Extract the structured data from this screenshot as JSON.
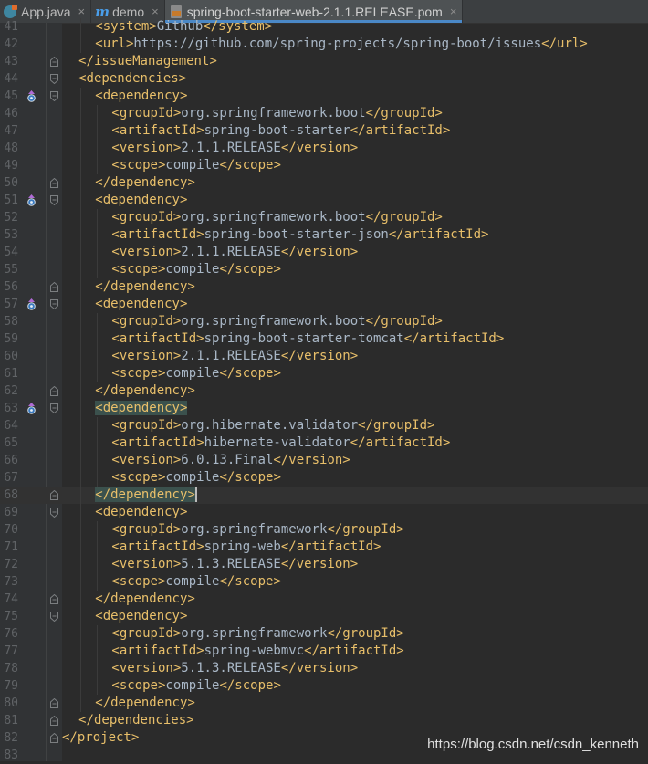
{
  "tabs": [
    {
      "label": "App.java",
      "icon": "java-class-icon",
      "active": false,
      "close": "×"
    },
    {
      "label": "demo",
      "icon": "maven-m-icon",
      "active": false,
      "close": "×"
    },
    {
      "label": "spring-boot-starter-web-2.1.1.RELEASE.pom",
      "icon": "pom-file-icon",
      "active": true,
      "close": "×"
    }
  ],
  "colors": {
    "background": "#2b2b2b",
    "tag": "#e8bf6a",
    "text": "#a9b7c6",
    "line_number": "#606366",
    "matched_tag_bg": "#3b514d"
  },
  "lines": [
    {
      "n": "41",
      "indent": 4,
      "parts": [
        [
          "t",
          "<system>"
        ],
        [
          "x",
          "Github"
        ],
        [
          "t",
          "</system>"
        ]
      ]
    },
    {
      "n": "42",
      "indent": 4,
      "parts": [
        [
          "t",
          "<url>"
        ],
        [
          "x",
          "https://github.com/spring-projects/spring-boot/issues"
        ],
        [
          "t",
          "</url>"
        ]
      ]
    },
    {
      "n": "43",
      "indent": 2,
      "fold": "end",
      "parts": [
        [
          "t",
          "</issueManagement>"
        ]
      ]
    },
    {
      "n": "44",
      "indent": 2,
      "fold": "start",
      "parts": [
        [
          "t",
          "<dependencies>"
        ]
      ]
    },
    {
      "n": "45",
      "indent": 4,
      "fold": "start",
      "impl": true,
      "parts": [
        [
          "t",
          "<dependency>"
        ]
      ]
    },
    {
      "n": "46",
      "indent": 6,
      "parts": [
        [
          "t",
          "<groupId>"
        ],
        [
          "x",
          "org.springframework.boot"
        ],
        [
          "t",
          "</groupId>"
        ]
      ]
    },
    {
      "n": "47",
      "indent": 6,
      "parts": [
        [
          "t",
          "<artifactId>"
        ],
        [
          "x",
          "spring-boot-starter"
        ],
        [
          "t",
          "</artifactId>"
        ]
      ]
    },
    {
      "n": "48",
      "indent": 6,
      "parts": [
        [
          "t",
          "<version>"
        ],
        [
          "x",
          "2.1.1.RELEASE"
        ],
        [
          "t",
          "</version>"
        ]
      ]
    },
    {
      "n": "49",
      "indent": 6,
      "parts": [
        [
          "t",
          "<scope>"
        ],
        [
          "x",
          "compile"
        ],
        [
          "t",
          "</scope>"
        ]
      ]
    },
    {
      "n": "50",
      "indent": 4,
      "fold": "end",
      "parts": [
        [
          "t",
          "</dependency>"
        ]
      ]
    },
    {
      "n": "51",
      "indent": 4,
      "fold": "start",
      "impl": true,
      "parts": [
        [
          "t",
          "<dependency>"
        ]
      ]
    },
    {
      "n": "52",
      "indent": 6,
      "parts": [
        [
          "t",
          "<groupId>"
        ],
        [
          "x",
          "org.springframework.boot"
        ],
        [
          "t",
          "</groupId>"
        ]
      ]
    },
    {
      "n": "53",
      "indent": 6,
      "parts": [
        [
          "t",
          "<artifactId>"
        ],
        [
          "x",
          "spring-boot-starter-json"
        ],
        [
          "t",
          "</artifactId>"
        ]
      ]
    },
    {
      "n": "54",
      "indent": 6,
      "parts": [
        [
          "t",
          "<version>"
        ],
        [
          "x",
          "2.1.1.RELEASE"
        ],
        [
          "t",
          "</version>"
        ]
      ]
    },
    {
      "n": "55",
      "indent": 6,
      "parts": [
        [
          "t",
          "<scope>"
        ],
        [
          "x",
          "compile"
        ],
        [
          "t",
          "</scope>"
        ]
      ]
    },
    {
      "n": "56",
      "indent": 4,
      "fold": "end",
      "parts": [
        [
          "t",
          "</dependency>"
        ]
      ]
    },
    {
      "n": "57",
      "indent": 4,
      "fold": "start",
      "impl": true,
      "parts": [
        [
          "t",
          "<dependency>"
        ]
      ]
    },
    {
      "n": "58",
      "indent": 6,
      "parts": [
        [
          "t",
          "<groupId>"
        ],
        [
          "x",
          "org.springframework.boot"
        ],
        [
          "t",
          "</groupId>"
        ]
      ]
    },
    {
      "n": "59",
      "indent": 6,
      "parts": [
        [
          "t",
          "<artifactId>"
        ],
        [
          "x",
          "spring-boot-starter-tomcat"
        ],
        [
          "t",
          "</artifactId>"
        ]
      ]
    },
    {
      "n": "60",
      "indent": 6,
      "parts": [
        [
          "t",
          "<version>"
        ],
        [
          "x",
          "2.1.1.RELEASE"
        ],
        [
          "t",
          "</version>"
        ]
      ]
    },
    {
      "n": "61",
      "indent": 6,
      "parts": [
        [
          "t",
          "<scope>"
        ],
        [
          "x",
          "compile"
        ],
        [
          "t",
          "</scope>"
        ]
      ]
    },
    {
      "n": "62",
      "indent": 4,
      "fold": "end",
      "parts": [
        [
          "t",
          "</dependency>"
        ]
      ]
    },
    {
      "n": "63",
      "indent": 4,
      "fold": "start",
      "impl": true,
      "parts": [
        [
          "hl",
          "<dependency>"
        ]
      ]
    },
    {
      "n": "64",
      "indent": 6,
      "parts": [
        [
          "t",
          "<groupId>"
        ],
        [
          "x",
          "org.hibernate.validator"
        ],
        [
          "t",
          "</groupId>"
        ]
      ]
    },
    {
      "n": "65",
      "indent": 6,
      "parts": [
        [
          "t",
          "<artifactId>"
        ],
        [
          "x",
          "hibernate-validator"
        ],
        [
          "t",
          "</artifactId>"
        ]
      ]
    },
    {
      "n": "66",
      "indent": 6,
      "parts": [
        [
          "t",
          "<version>"
        ],
        [
          "x",
          "6.0.13.Final"
        ],
        [
          "t",
          "</version>"
        ]
      ]
    },
    {
      "n": "67",
      "indent": 6,
      "parts": [
        [
          "t",
          "<scope>"
        ],
        [
          "x",
          "compile"
        ],
        [
          "t",
          "</scope>"
        ]
      ]
    },
    {
      "n": "68",
      "indent": 4,
      "fold": "end",
      "current": true,
      "caret": true,
      "parts": [
        [
          "hl",
          "</dependency>"
        ]
      ]
    },
    {
      "n": "69",
      "indent": 4,
      "fold": "start",
      "parts": [
        [
          "t",
          "<dependency>"
        ]
      ]
    },
    {
      "n": "70",
      "indent": 6,
      "parts": [
        [
          "t",
          "<groupId>"
        ],
        [
          "x",
          "org.springframework"
        ],
        [
          "t",
          "</groupId>"
        ]
      ]
    },
    {
      "n": "71",
      "indent": 6,
      "parts": [
        [
          "t",
          "<artifactId>"
        ],
        [
          "x",
          "spring-web"
        ],
        [
          "t",
          "</artifactId>"
        ]
      ]
    },
    {
      "n": "72",
      "indent": 6,
      "parts": [
        [
          "t",
          "<version>"
        ],
        [
          "x",
          "5.1.3.RELEASE"
        ],
        [
          "t",
          "</version>"
        ]
      ]
    },
    {
      "n": "73",
      "indent": 6,
      "parts": [
        [
          "t",
          "<scope>"
        ],
        [
          "x",
          "compile"
        ],
        [
          "t",
          "</scope>"
        ]
      ]
    },
    {
      "n": "74",
      "indent": 4,
      "fold": "end",
      "parts": [
        [
          "t",
          "</dependency>"
        ]
      ]
    },
    {
      "n": "75",
      "indent": 4,
      "fold": "start",
      "parts": [
        [
          "t",
          "<dependency>"
        ]
      ]
    },
    {
      "n": "76",
      "indent": 6,
      "parts": [
        [
          "t",
          "<groupId>"
        ],
        [
          "x",
          "org.springframework"
        ],
        [
          "t",
          "</groupId>"
        ]
      ]
    },
    {
      "n": "77",
      "indent": 6,
      "parts": [
        [
          "t",
          "<artifactId>"
        ],
        [
          "x",
          "spring-webmvc"
        ],
        [
          "t",
          "</artifactId>"
        ]
      ]
    },
    {
      "n": "78",
      "indent": 6,
      "parts": [
        [
          "t",
          "<version>"
        ],
        [
          "x",
          "5.1.3.RELEASE"
        ],
        [
          "t",
          "</version>"
        ]
      ]
    },
    {
      "n": "79",
      "indent": 6,
      "parts": [
        [
          "t",
          "<scope>"
        ],
        [
          "x",
          "compile"
        ],
        [
          "t",
          "</scope>"
        ]
      ]
    },
    {
      "n": "80",
      "indent": 4,
      "fold": "end",
      "parts": [
        [
          "t",
          "</dependency>"
        ]
      ]
    },
    {
      "n": "81",
      "indent": 2,
      "fold": "end",
      "parts": [
        [
          "t",
          "</dependencies>"
        ]
      ]
    },
    {
      "n": "82",
      "indent": 0,
      "fold": "end",
      "parts": [
        [
          "t",
          "</project>"
        ]
      ]
    },
    {
      "n": "83",
      "indent": 0,
      "parts": []
    }
  ],
  "watermark": "https://blog.csdn.net/csdn_kenneth"
}
